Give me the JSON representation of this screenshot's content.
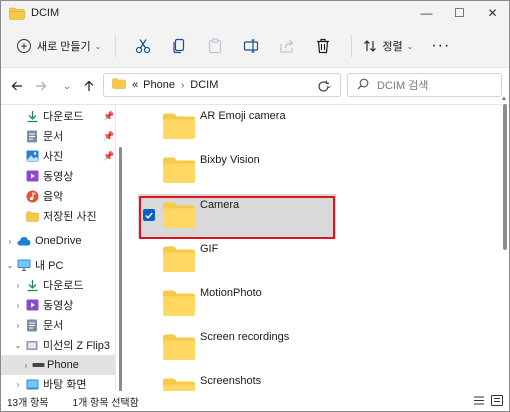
{
  "window": {
    "title": "DCIM",
    "controls": {
      "minimize": "—",
      "maximize": "☐",
      "close": "✕"
    }
  },
  "command_bar": {
    "new_label": "새로 만들기",
    "sort_label": "정렬",
    "more_label": "···",
    "icons": [
      "cut-icon",
      "copy-icon",
      "paste-icon",
      "rename-icon",
      "share-icon",
      "delete-icon"
    ]
  },
  "address_bar": {
    "overflow": "«",
    "crumbs": [
      "Phone",
      "DCIM"
    ],
    "search_placeholder": "DCIM 검색"
  },
  "sidebar": {
    "quick_access": [
      {
        "label": "다운로드",
        "icon": "download-icon",
        "pinned": true
      },
      {
        "label": "문서",
        "icon": "document-icon",
        "pinned": true
      },
      {
        "label": "사진",
        "icon": "picture-icon",
        "pinned": true
      },
      {
        "label": "동영상",
        "icon": "video-icon",
        "pinned": false
      },
      {
        "label": "음악",
        "icon": "music-icon",
        "pinned": false
      },
      {
        "label": "저장된 사진",
        "icon": "folder-icon",
        "pinned": false
      }
    ],
    "onedrive": "OneDrive",
    "this_pc": "내 PC",
    "pc_items": [
      {
        "label": "다운로드",
        "icon": "download-icon"
      },
      {
        "label": "동영상",
        "icon": "video-icon"
      },
      {
        "label": "문서",
        "icon": "document-icon"
      },
      {
        "label": "미선의 Z Flip3",
        "icon": "phone-icon"
      },
      {
        "label": "Phone",
        "icon": "drive-icon"
      },
      {
        "label": "바탕 화면",
        "icon": "desktop-icon"
      }
    ]
  },
  "files": [
    {
      "name": "AR Emoji camera",
      "selected": false
    },
    {
      "name": "Bixby Vision",
      "selected": false
    },
    {
      "name": "Camera",
      "selected": true
    },
    {
      "name": "GIF",
      "selected": false
    },
    {
      "name": "MotionPhoto",
      "selected": false
    },
    {
      "name": "Screen recordings",
      "selected": false
    },
    {
      "name": "Screenshots",
      "selected": false
    }
  ],
  "status": {
    "count": "13개 항목",
    "selection": "1개 항목 선택함"
  },
  "colors": {
    "accent": "#0a5fc4",
    "highlight_box": "#e0141e",
    "folder": "#f6c94a"
  }
}
